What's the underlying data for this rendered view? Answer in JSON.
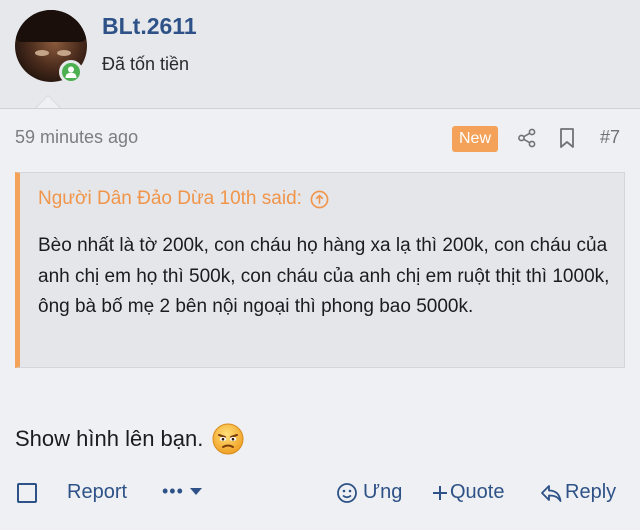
{
  "post": {
    "username": "BLt.2611",
    "user_title": "Đã tốn tiền",
    "time": "59 minutes ago",
    "new_badge": "New",
    "post_number": "#7"
  },
  "quote": {
    "author_line": "Người Dân Đảo Dừa 10th said:",
    "text": "Bèo nhất là tờ 200k, con cháu họ hàng xa lạ thì 200k, con cháu của anh chị em họ thì 500k, con cháu của anh chị em ruột thịt thì 1000k, ông bà bố mẹ 2 bên nội ngoại thì phong bao 5000k."
  },
  "message": {
    "text": "Show hình lên bạn."
  },
  "footer": {
    "report": "Report",
    "more": "•••",
    "react": "Ưng",
    "quote": "Quote",
    "reply": "Reply"
  },
  "colors": {
    "link": "#2e5287",
    "accent": "#f4a259",
    "online": "#4caf50"
  },
  "icons": [
    "avatar",
    "online-icon",
    "share-icon",
    "bookmark-icon",
    "arrow-up-circle-icon",
    "emoji-icon",
    "chevron-down-icon",
    "react-icon",
    "plus-icon",
    "reply-icon"
  ]
}
